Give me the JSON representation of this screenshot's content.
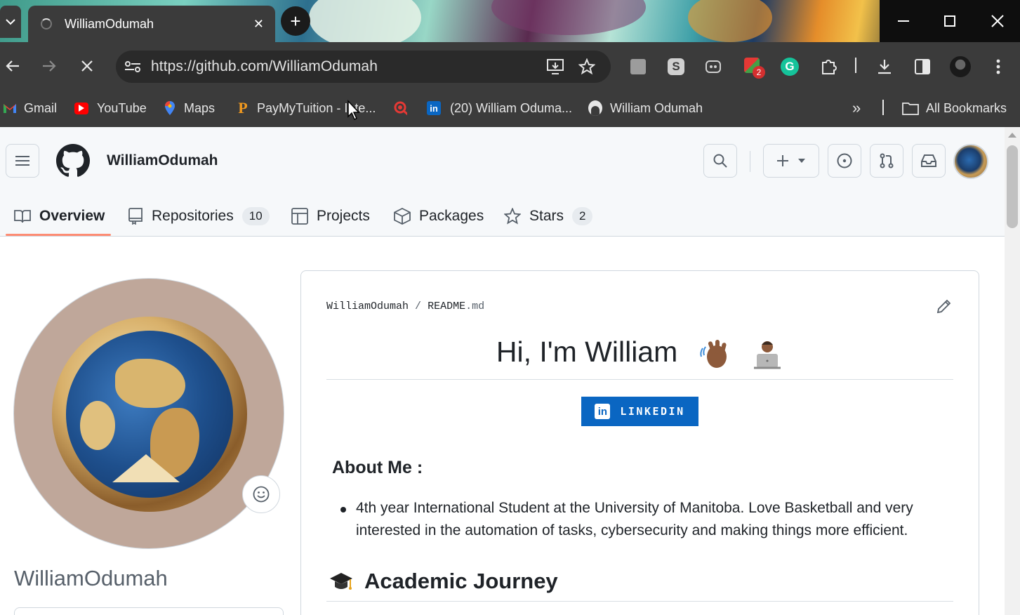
{
  "browser": {
    "tab_title": "WilliamOdumah",
    "new_tab_symbol": "+",
    "tab_close_symbol": "✕",
    "url": "https://github.com/WilliamOdumah",
    "extension_badge": "2"
  },
  "bookmarks": {
    "items": [
      {
        "label": "Gmail",
        "icon": "gmail-icon"
      },
      {
        "label": "YouTube",
        "icon": "youtube-icon"
      },
      {
        "label": "Maps",
        "icon": "maps-icon"
      },
      {
        "label": "PayMyTuition - Inte...",
        "icon": "paymytuition-icon"
      },
      {
        "label": "",
        "icon": "search-bookmark-icon"
      },
      {
        "label": "(20) William Oduma...",
        "icon": "linkedin-icon"
      },
      {
        "label": "William Odumah",
        "icon": "github-icon"
      }
    ],
    "overflow_symbol": "»",
    "all_bookmarks": "All Bookmarks"
  },
  "github": {
    "header_username": "WilliamOdumah",
    "tabs": [
      {
        "label": "Overview",
        "count": null
      },
      {
        "label": "Repositories",
        "count": "10"
      },
      {
        "label": "Projects",
        "count": null
      },
      {
        "label": "Packages",
        "count": null
      },
      {
        "label": "Stars",
        "count": "2"
      }
    ],
    "profile_login": "WilliamOdumah"
  },
  "readme": {
    "crumb_user": "WilliamOdumah",
    "crumb_sep": "/",
    "crumb_file": "README",
    "crumb_ext": ".md",
    "heading": "Hi, I'm William",
    "linkedin_label": "LINKEDIN",
    "linkedin_logo": "in",
    "about_heading": "About Me :",
    "about_bullet": "4th year International Student at the University of Manitoba. Love Basketball and very interested in the automation of tasks, cybersecurity and making things more efficient.",
    "academic_heading": "Academic Journey"
  },
  "colors": {
    "browser_chrome": "#3b3b3b",
    "github_header_bg": "#f6f8fa",
    "active_tab_underline": "#fd8c73",
    "linkedin_blue": "#0a66c2"
  }
}
